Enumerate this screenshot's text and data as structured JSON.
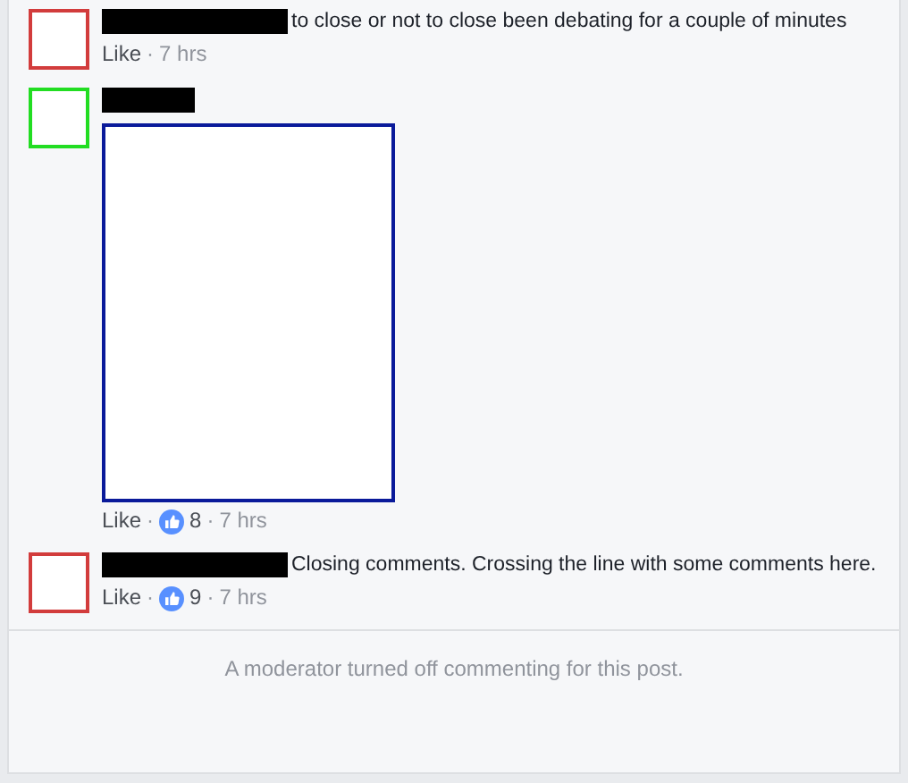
{
  "comments": [
    {
      "avatar": {
        "color": "#d23c3c"
      },
      "redacted": true,
      "text": "to close or not to close been debating for a couple of minutes",
      "footer": [
        {
          "kind": "link",
          "text": "Like"
        },
        {
          "kind": "dot",
          "text": "·"
        },
        {
          "kind": "time",
          "text": "7 hrs"
        }
      ]
    },
    {
      "avatar": {
        "color": "#22dd22"
      },
      "redacted": true,
      "attachment": {
        "kind": "blank-image",
        "color": "#0a1a9a"
      },
      "footer": [
        {
          "kind": "link",
          "text": "Like"
        },
        {
          "kind": "dot",
          "text": "·"
        },
        {
          "kind": "likes",
          "text": "8"
        },
        {
          "kind": "dot",
          "text": "·"
        },
        {
          "kind": "time",
          "text": "7 hrs"
        }
      ]
    },
    {
      "avatar": {
        "color": "#d23c3c"
      },
      "redacted": true,
      "text": "Closing comments. Crossing the line with some comments here.",
      "footer": [
        {
          "kind": "link",
          "text": "Like"
        },
        {
          "kind": "dot",
          "text": "·"
        },
        {
          "kind": "likes",
          "text": "9"
        },
        {
          "kind": "dot",
          "text": "·"
        },
        {
          "kind": "time",
          "text": "7 hrs"
        }
      ]
    }
  ],
  "notice": "A moderator turned off commenting for this post."
}
